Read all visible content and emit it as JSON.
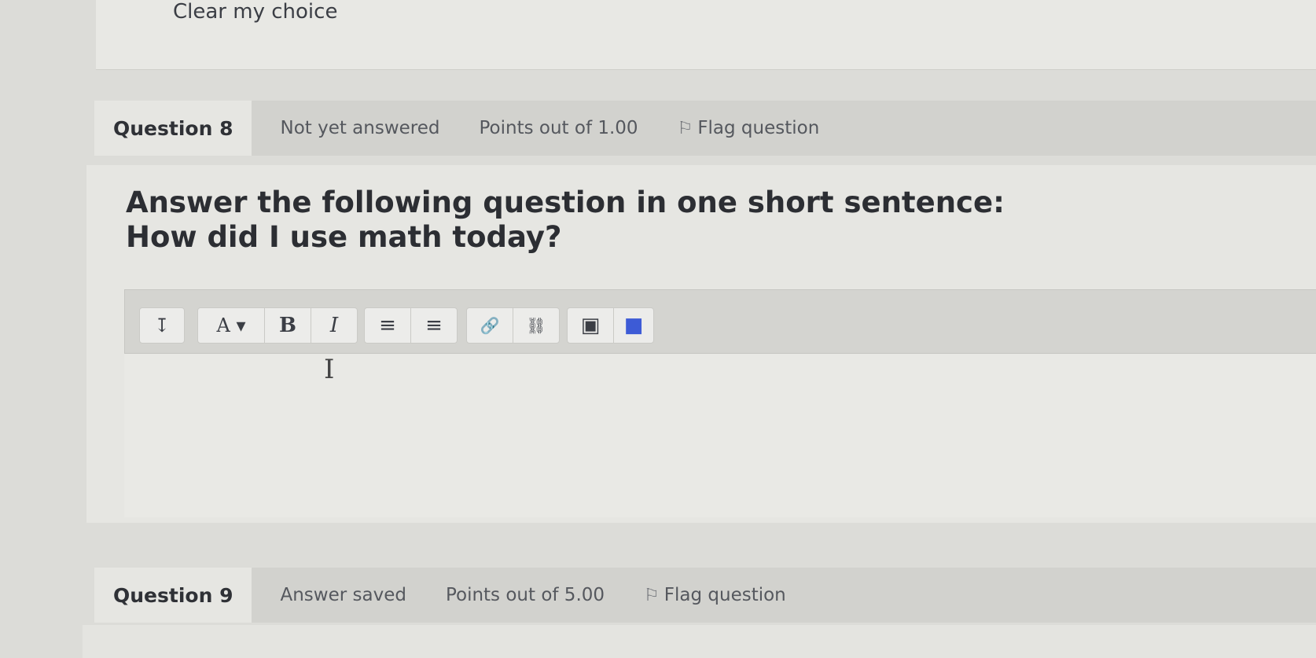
{
  "previous_question": {
    "clear_choice_label": "Clear my choice"
  },
  "question8": {
    "number_label": "Question 8",
    "state": "Not yet answered",
    "points": "Points out of 1.00",
    "flag_label": "Flag question",
    "text_line1": "Answer the following question in one short sentence:",
    "text_line2": "How did I use math today?",
    "toolbar": {
      "toggle_icon": "↧",
      "font_label": "A ▾",
      "bold_label": "B",
      "italic_label": "I",
      "bullet_icon": "≡",
      "numbered_icon": "≡",
      "link_icon": "🔗",
      "unlink_icon": "⛓",
      "image_icon": "▣",
      "media_icon": "■"
    },
    "editor_value": ""
  },
  "question9": {
    "number_label": "Question 9",
    "state": "Answer saved",
    "points": "Points out of 5.00",
    "flag_label": "Flag question"
  },
  "colors": {
    "media_blue": "#3d5bd6",
    "background": "#dcdcd8",
    "card": "#e6e6e2"
  }
}
